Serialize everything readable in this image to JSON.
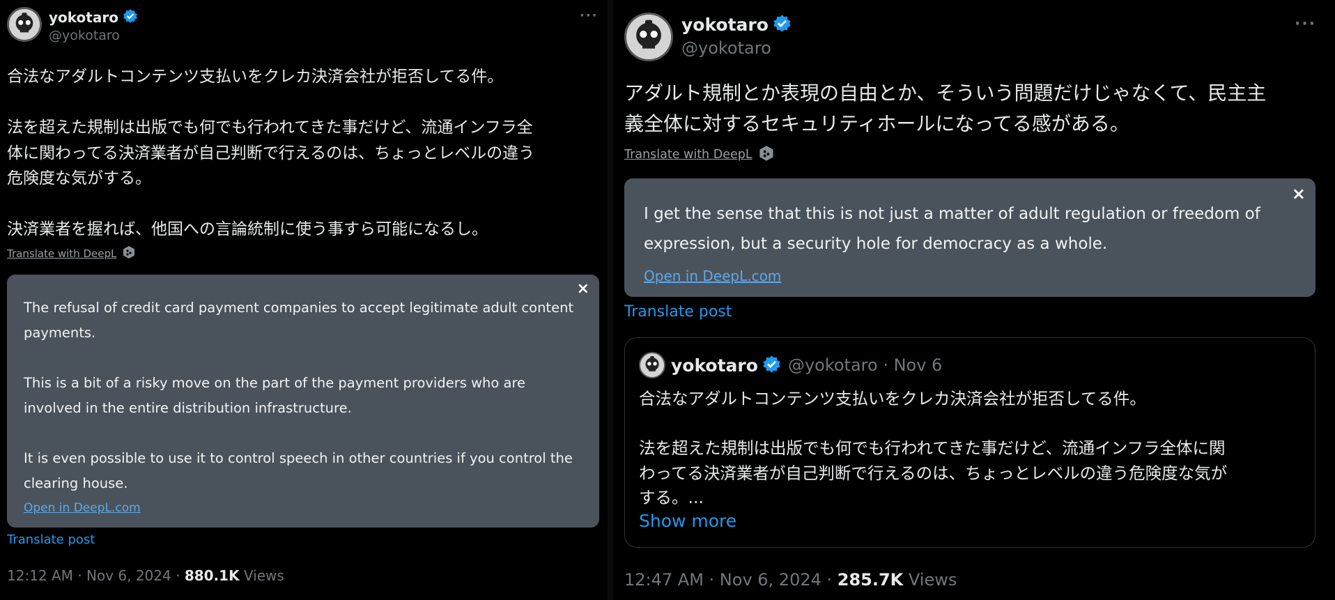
{
  "left_post": {
    "display_name": "yokotaro",
    "handle": "@yokotaro",
    "more": "···",
    "text": "合法なアダルトコンテンツ支払いをクレカ決済会社が拒否してる件。\n\n法を超えた規制は出版でも何でも行われてきた事だけど、流通インフラ全\n体に関わってる決済業者が自己判断で行えるのは、ちょっとレベルの違う\n危険度な気がする。\n\n決済業者を握れば、他国への言論統制に使う事すら可能になるし。",
    "translate_with": "Translate with DeepL",
    "translation": "The refusal of credit card payment companies to accept legitimate adult content\npayments.\n\nThis is a bit of a risky move on the part of the payment providers who are\ninvolved in the entire distribution infrastructure.\n\nIt is even possible to use it to control speech in other countries if you control the\nclearing house.",
    "close": "×",
    "open_deepl": "Open in DeepL.com",
    "translate_post": "Translate post",
    "timestamp": "12:12 AM · Nov 6, 2024 · ",
    "views_count": "880.1K",
    "views_label": " Views"
  },
  "right_post": {
    "display_name": "yokotaro",
    "handle": "@yokotaro",
    "more": "···",
    "text": "アダルト規制とか表現の自由とか、そういう問題だけじゃなくて、民主主\n義全体に対するセキュリティホールになってる感がある。",
    "translate_with": "Translate with DeepL",
    "translation": "I get the sense that this is not just a matter of adult regulation or freedom of\nexpression, but a security hole for democracy as a whole.",
    "close": "×",
    "open_deepl": "Open in DeepL.com",
    "translate_post": "Translate post",
    "quote": {
      "display_name": "yokotaro",
      "handle_date": "@yokotaro · Nov 6",
      "text": "合法なアダルトコンテンツ支払いをクレカ決済会社が拒否してる件。\n\n法を超えた規制は出版でも何でも行われてきた事だけど、流通インフラ全体に関\nわってる決済業者が自己判断で行えるのは、ちょっとレベルの違う危険度な気が\nする。...",
      "show_more": "Show more"
    },
    "timestamp": "12:47 AM · Nov 6, 2024 · ",
    "views_count": "285.7K",
    "views_label": " Views"
  },
  "colors": {
    "background": "#000000",
    "translation_box": "#4a535c",
    "link_blue": "#1d9bf0",
    "verified_blue": "#1d9bf0",
    "muted": "#71767b"
  }
}
